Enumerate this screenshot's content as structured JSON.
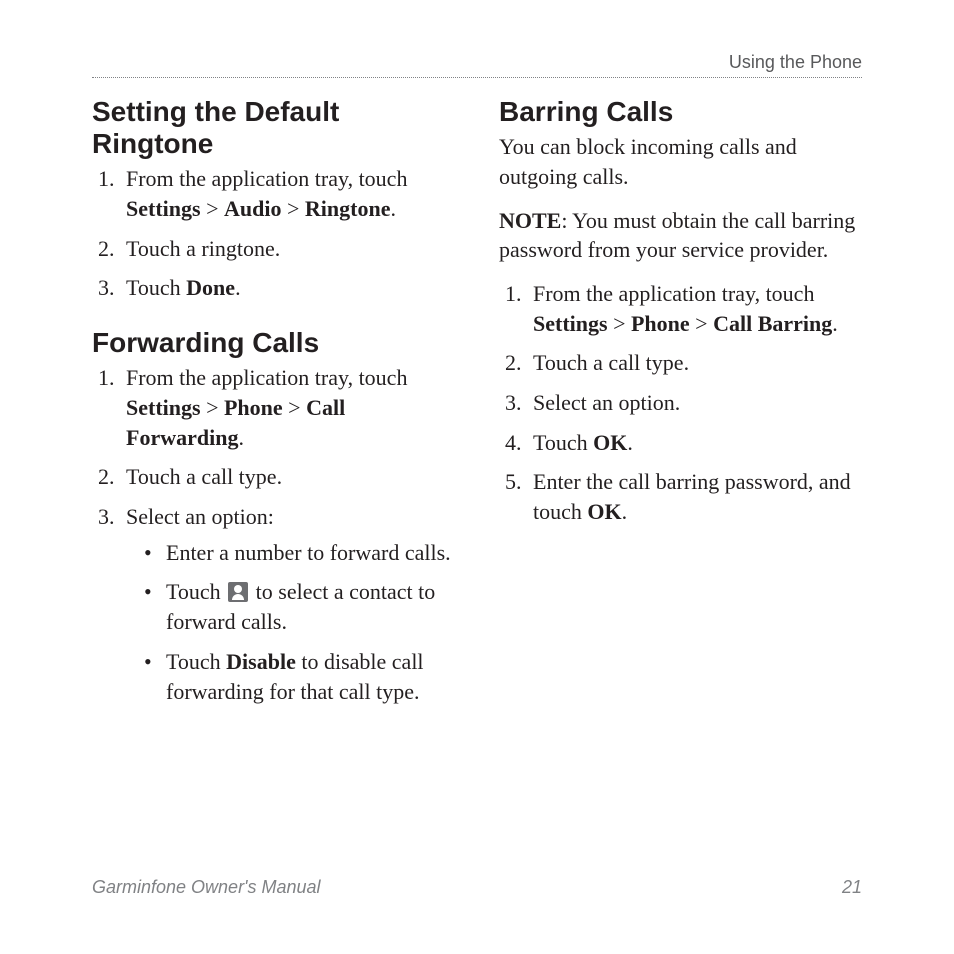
{
  "runhead": "Using the Phone",
  "footer": {
    "left": "Garminfone Owner's Manual",
    "right": "21"
  },
  "left": {
    "sec1": {
      "title": "Setting the Default Ringtone",
      "step1_a": "From the application tray, touch ",
      "step1_b1": "Settings",
      "step1_gt1": " > ",
      "step1_b2": "Audio",
      "step1_gt2": " > ",
      "step1_b3": "Ringtone",
      "step1_c": ".",
      "step2": "Touch a ringtone.",
      "step3_a": "Touch ",
      "step3_b": "Done",
      "step3_c": "."
    },
    "sec2": {
      "title": "Forwarding Calls",
      "step1_a": "From the application tray, touch ",
      "step1_b1": "Settings",
      "step1_gt1": " > ",
      "step1_b2": "Phone",
      "step1_gt2": " > ",
      "step1_b3": "Call Forwarding",
      "step1_c": ".",
      "step2": "Touch a call type.",
      "step3": "Select an option:",
      "opt1": "Enter a number to forward calls.",
      "opt2_a": "Touch ",
      "opt2_b": " to select a contact to forward calls.",
      "opt3_a": "Touch ",
      "opt3_b": "Disable",
      "opt3_c": " to disable call forwarding for that call type."
    }
  },
  "right": {
    "sec1": {
      "title": "Barring Calls",
      "para": "You can block incoming calls and outgoing calls.",
      "note_label": "NOTE",
      "note_text": ": You must obtain the call barring password from your service provider.",
      "step1_a": "From the application tray, touch ",
      "step1_b1": "Settings",
      "step1_gt1": " > ",
      "step1_b2": "Phone",
      "step1_gt2": " > ",
      "step1_b3": "Call Barring",
      "step1_c": ".",
      "step2": "Touch a call type.",
      "step3": "Select an option.",
      "step4_a": "Touch ",
      "step4_b": "OK",
      "step4_c": ".",
      "step5_a": "Enter the call barring password, and touch ",
      "step5_b": "OK",
      "step5_c": "."
    }
  }
}
